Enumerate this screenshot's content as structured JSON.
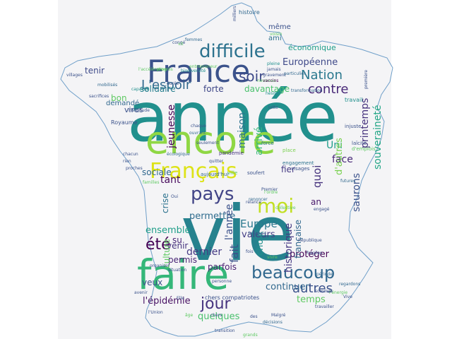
{
  "colors": {
    "background": "#ffffff",
    "panel": "#f4f4f6",
    "outline": "#6f9fc9",
    "palette": [
      "#440154",
      "#3b528b",
      "#21908d",
      "#5dc863",
      "#fde725"
    ]
  },
  "words": [
    {
      "text": "année",
      "color": "#21908d"
    },
    {
      "text": "vie",
      "color": "#26828e"
    },
    {
      "text": "encore",
      "color": "#8fd744"
    },
    {
      "text": "France",
      "color": "#3b528b"
    },
    {
      "text": "faire",
      "color": "#35b779"
    },
    {
      "text": "Français",
      "color": "#dde318"
    },
    {
      "text": "difficile",
      "color": "#2c728e"
    },
    {
      "text": "beaucoup",
      "color": "#31688e"
    },
    {
      "text": "pays",
      "color": "#414487"
    },
    {
      "text": "moi",
      "color": "#c2df23"
    },
    {
      "text": "Nation",
      "color": "#2a788e"
    },
    {
      "text": "L'espoir",
      "color": "#31688e"
    },
    {
      "text": "contre",
      "color": "#482878"
    },
    {
      "text": "été",
      "color": "#440154"
    },
    {
      "text": "jour",
      "color": "#46337e"
    },
    {
      "text": "soir",
      "color": "#3e4a89"
    },
    {
      "text": "autres",
      "color": "#3b528b"
    },
    {
      "text": "Européenne",
      "color": "#3e4989"
    },
    {
      "text": "temps",
      "color": "#5ec962"
    },
    {
      "text": "dernier",
      "color": "#443983"
    },
    {
      "text": "fait",
      "color": "#3b528b"
    },
    {
      "text": "solidaire",
      "color": "#277f8e"
    },
    {
      "text": "forte",
      "color": "#3f4788"
    },
    {
      "text": "davantage",
      "color": "#4ac16d"
    },
    {
      "text": "permettre",
      "color": "#2f6c8e"
    },
    {
      "text": "ensemble",
      "color": "#1f9e89"
    },
    {
      "text": "quelques",
      "color": "#4ac16d"
    },
    {
      "text": "Europe",
      "color": "#2a788e"
    },
    {
      "text": "protéger",
      "color": "#440154"
    },
    {
      "text": "valeurs",
      "color": "#433e85"
    },
    {
      "text": "continuer",
      "color": "#31688e"
    },
    {
      "text": "parfois",
      "color": "#481f70"
    },
    {
      "text": "l'épidémie",
      "color": "#471063"
    },
    {
      "text": "veux",
      "color": "#3b528b"
    },
    {
      "text": "tant",
      "color": "#46085c"
    },
    {
      "text": "sociale",
      "color": "#31688e"
    },
    {
      "text": "tenir",
      "color": "#3e4a89"
    },
    {
      "text": "bon",
      "color": "#5ec962"
    },
    {
      "text": "Uni",
      "color": "#1f9e89"
    },
    {
      "text": "face",
      "color": "#482878"
    },
    {
      "text": "quoi",
      "color": "#46337e"
    },
    {
      "text": "an",
      "color": "#48186a"
    },
    {
      "text": "même",
      "color": "#3b528b"
    },
    {
      "text": "ami",
      "color": "#2c728e"
    },
    {
      "text": "économique",
      "color": "#1f9e89"
    },
    {
      "text": "demandé",
      "color": "#31688e"
    },
    {
      "text": "virus",
      "color": "#3b528b"
    },
    {
      "text": "su",
      "color": "#482878"
    },
    {
      "text": "venir",
      "color": "#46337e"
    },
    {
      "text": "permis",
      "color": "#482475"
    },
    {
      "text": "fier",
      "color": "#443983"
    },
    {
      "text": "Royaume",
      "color": "#3b528b"
    },
    {
      "text": "choix",
      "color": "#21908d"
    },
    {
      "text": "maison",
      "color": "#2c728e"
    },
    {
      "text": "arrivé",
      "color": "#35b779"
    },
    {
      "text": "l'année",
      "color": "#3b528b"
    },
    {
      "text": "jeunesse",
      "color": "#440154"
    },
    {
      "text": "crise",
      "color": "#2c728e"
    },
    {
      "text": "culture",
      "color": "#5ec962"
    },
    {
      "text": "historique",
      "color": "#443983"
    },
    {
      "text": "française",
      "color": "#31688e"
    },
    {
      "text": "saurons",
      "color": "#3b528b"
    },
    {
      "text": "printemps",
      "color": "#46337e"
    },
    {
      "text": "souveraineté",
      "color": "#21a585"
    },
    {
      "text": "d'autres",
      "color": "#7ad151"
    },
    {
      "text": "chers compatriotes",
      "color": "#3b528b"
    },
    {
      "text": "pandémie",
      "color": "#46337e"
    },
    {
      "text": "aujourd'hui",
      "color": "#31688e"
    },
    {
      "text": "soufert",
      "color": "#3b528b"
    },
    {
      "text": "ville",
      "color": "#5ec962"
    },
    {
      "text": "engagement",
      "color": "#2c728e"
    },
    {
      "text": "visages",
      "color": "#3b528b"
    },
    {
      "text": "place",
      "color": "#7ad151"
    },
    {
      "text": "force",
      "color": "#2c728e"
    },
    {
      "text": "injuste",
      "color": "#3b528b"
    },
    {
      "text": "travail",
      "color": "#21908d"
    },
    {
      "text": "laïcité",
      "color": "#3b528b"
    },
    {
      "text": "d'emplois",
      "color": "#5ec962"
    },
    {
      "text": "gravement",
      "color": "#3b528b"
    },
    {
      "text": "nouveau",
      "color": "#5ec962"
    },
    {
      "text": "pleine",
      "color": "#21908d"
    },
    {
      "text": "jamais",
      "color": "#3b528b"
    },
    {
      "text": "vaccins",
      "color": "#440154"
    },
    {
      "text": "hésité",
      "color": "#21908d"
    },
    {
      "text": "lutte",
      "color": "#3b528b"
    },
    {
      "text": "transformation",
      "color": "#31688e"
    },
    {
      "text": "voisin",
      "color": "#5ec962"
    },
    {
      "text": "histoire",
      "color": "#31688e"
    },
    {
      "text": "milliers",
      "color": "#3b528b"
    },
    {
      "text": "congé",
      "color": "#3b528b"
    },
    {
      "text": "vit",
      "color": "#5ec962"
    },
    {
      "text": "femmes",
      "color": "#31688e"
    },
    {
      "text": "entrepreneur",
      "color": "#5ec962"
    },
    {
      "text": "biodiversité",
      "color": "#21908d"
    },
    {
      "text": "durée",
      "color": "#3b528b"
    },
    {
      "text": "progrès",
      "color": "#5ec962"
    },
    {
      "text": "villages",
      "color": "#3b528b"
    },
    {
      "text": "mobilisés",
      "color": "#31688e"
    },
    {
      "text": "sacrifices",
      "color": "#3b528b"
    },
    {
      "text": "l'accélération",
      "color": "#5ec962"
    },
    {
      "text": "capacité",
      "color": "#21908d"
    },
    {
      "text": "l'habitude",
      "color": "#3b528b"
    },
    {
      "text": "première",
      "color": "#3b528b"
    },
    {
      "text": "chaque",
      "color": "#3b528b"
    },
    {
      "text": "ouvrant",
      "color": "#31688e"
    },
    {
      "text": "chacun",
      "color": "#3b528b"
    },
    {
      "text": "seulement",
      "color": "#3b528b"
    },
    {
      "text": "quitter",
      "color": "#3b528b"
    },
    {
      "text": "proches",
      "color": "#3b528b"
    },
    {
      "text": "rien",
      "color": "#3b528b"
    },
    {
      "text": "familles",
      "color": "#5ec962"
    },
    {
      "text": "écologique",
      "color": "#31688e"
    },
    {
      "text": "futures",
      "color": "#31688e"
    },
    {
      "text": "Oui",
      "color": "#3b528b"
    },
    {
      "text": "Premier",
      "color": "#3b528b"
    },
    {
      "text": "l'ordre",
      "color": "#5ec962"
    },
    {
      "text": "relance",
      "color": "#3b528b"
    },
    {
      "text": "engagé",
      "color": "#3b528b"
    },
    {
      "text": "renoncer",
      "color": "#31688e"
    },
    {
      "text": "République",
      "color": "#3b528b"
    },
    {
      "text": "collective",
      "color": "#5ec962"
    },
    {
      "text": "fois",
      "color": "#3b528b"
    },
    {
      "text": "vivre",
      "color": "#5ec962"
    },
    {
      "text": "fragiles",
      "color": "#3b528b"
    },
    {
      "text": "période",
      "color": "#31688e"
    },
    {
      "text": "regardons",
      "color": "#31688e"
    },
    {
      "text": "l'énergie",
      "color": "#5ec962"
    },
    {
      "text": "Vive",
      "color": "#3b528b"
    },
    {
      "text": "travailler",
      "color": "#3b528b"
    },
    {
      "text": "situation",
      "color": "#3b528b"
    },
    {
      "text": "organiser",
      "color": "#3b528b"
    },
    {
      "text": "personne",
      "color": "#3b528b"
    },
    {
      "text": "avenir",
      "color": "#3b528b"
    },
    {
      "text": "l'Union",
      "color": "#3b528b"
    },
    {
      "text": "transition",
      "color": "#3b528b"
    },
    {
      "text": "laisserai",
      "color": "#31688e"
    },
    {
      "text": "sommes",
      "color": "#3b528b"
    },
    {
      "text": "Malgré",
      "color": "#3b528b"
    },
    {
      "text": "grands",
      "color": "#5ec962"
    },
    {
      "text": "particulier",
      "color": "#31688e"
    },
    {
      "text": "des",
      "color": "#3b528b"
    },
    {
      "text": "Elle",
      "color": "#3b528b"
    },
    {
      "text": "chers",
      "color": "#3b528b"
    },
    {
      "text": "âge",
      "color": "#5ec962"
    },
    {
      "text": "décisions",
      "color": "#31688e"
    },
    {
      "text": "besoin",
      "color": "#3b528b"
    }
  ]
}
